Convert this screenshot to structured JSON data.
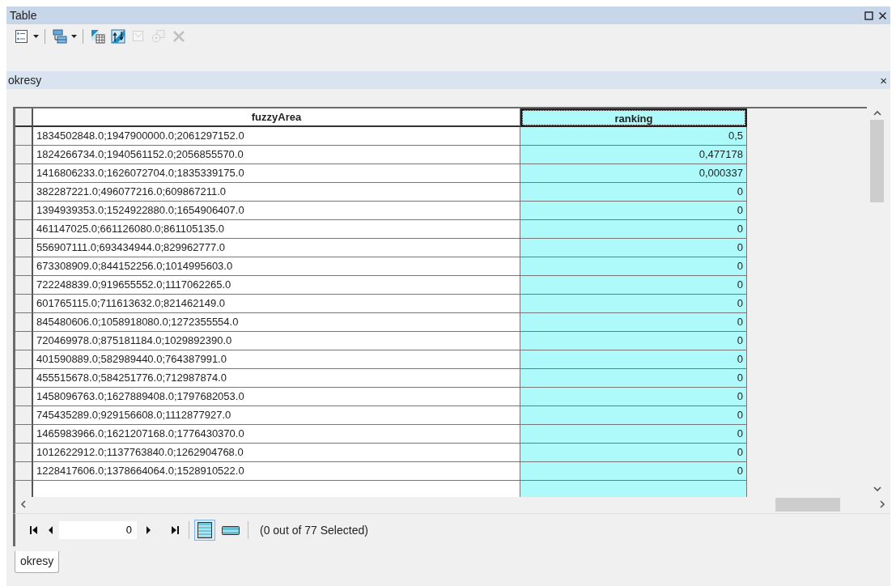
{
  "window": {
    "title": "Table",
    "buttons": [
      {
        "kind": "maximize"
      },
      {
        "kind": "close"
      }
    ]
  },
  "toolbar": [
    {
      "kind": "table-options",
      "dropdown": true,
      "disabled": false
    },
    {
      "kind": "related-tables",
      "dropdown": true,
      "disabled": false
    },
    {
      "kind": "select-by-attributes",
      "dropdown": false,
      "disabled": false
    },
    {
      "kind": "switch-selection",
      "dropdown": false,
      "disabled": false
    },
    {
      "kind": "clear-selection",
      "dropdown": false,
      "disabled": true
    },
    {
      "kind": "zoom-to-selected",
      "dropdown": false,
      "disabled": true
    },
    {
      "kind": "delete",
      "dropdown": false,
      "disabled": true
    }
  ],
  "table_tab_header": {
    "title": "okresy",
    "close": "×"
  },
  "table": {
    "columns": [
      {
        "name": "fuzzyArea",
        "selected": false
      },
      {
        "name": "ranking",
        "selected": true
      }
    ],
    "rows": [
      [
        "1834502848.0;1947900000.0;2061297152.0",
        "0,5"
      ],
      [
        "1824266734.0;1940561152.0;2056855570.0",
        "0,477178"
      ],
      [
        "1416806233.0;1626072704.0;1835339175.0",
        "0,000337"
      ],
      [
        "382287221.0;496077216.0;609867211.0",
        "0"
      ],
      [
        "1394939353.0;1524922880.0;1654906407.0",
        "0"
      ],
      [
        "461147025.0;661126080.0;861105135.0",
        "0"
      ],
      [
        "556907111.0;693434944.0;829962777.0",
        "0"
      ],
      [
        "673308909.0;844152256.0;1014995603.0",
        "0"
      ],
      [
        "722248839.0;919655552.0;1117062265.0",
        "0"
      ],
      [
        "601765115.0;711613632.0;821462149.0",
        "0"
      ],
      [
        "845480606.0;1058918080.0;1272355554.0",
        "0"
      ],
      [
        "720469978.0;875181184.0;1029892390.0",
        "0"
      ],
      [
        "401590889.0;582989440.0;764387991.0",
        "0"
      ],
      [
        "455515678.0;584251776.0;712987874.0",
        "0"
      ],
      [
        "1458096763.0;1627889408.0;1797682053.0",
        "0"
      ],
      [
        "745435289.0;929156608.0;1112877927.0",
        "0"
      ],
      [
        "1465983966.0;1621207168.0;1776430370.0",
        "0"
      ],
      [
        "1012622912.0;1137763840.0;1262904768.0",
        "0"
      ],
      [
        "1228417606.0;1378664064.0;1528910522.0",
        "0"
      ]
    ]
  },
  "navigation": {
    "record": "0",
    "views": [
      {
        "kind": "all",
        "selected": true
      },
      {
        "kind": "selected",
        "selected": false
      }
    ],
    "status": "(0 out of 77 Selected)"
  },
  "bottom_tabs": [
    {
      "label": "okresy",
      "selected": true
    }
  ]
}
